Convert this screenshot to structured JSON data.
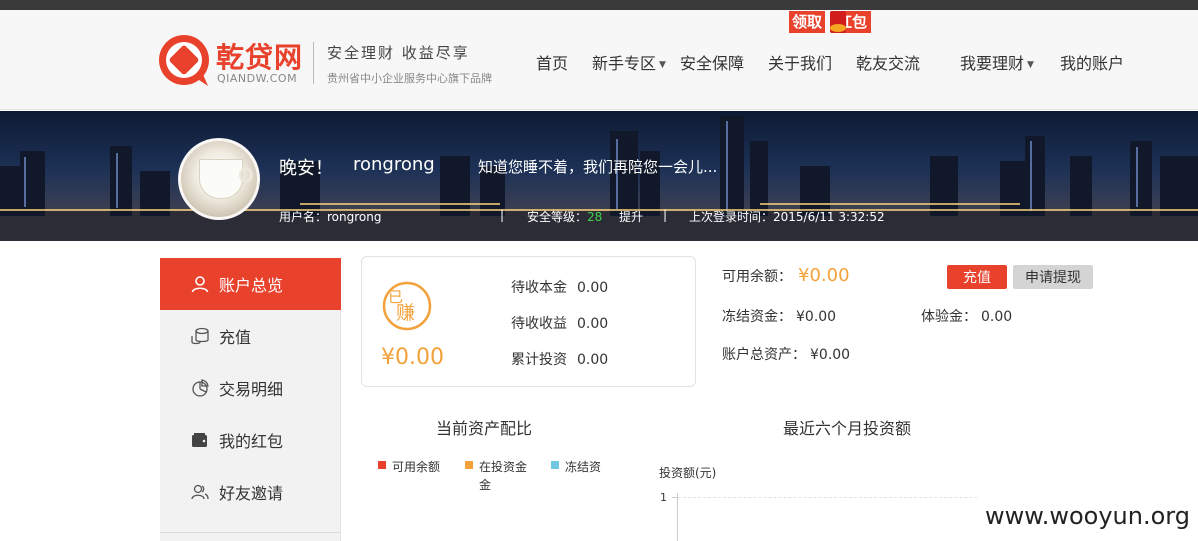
{
  "header": {
    "brand_cn": "乾贷网",
    "brand_en": "QIANDW.COM",
    "slogan": "安全理财 收益尽享",
    "slogan_sub": "贵州省中小企业服务中心旗下品牌",
    "nav": [
      "首页",
      "新手专区",
      "安全保障",
      "关于我们",
      "乾友交流",
      "我要理财",
      "我的账户"
    ],
    "promo": [
      "领取",
      "红包"
    ],
    "brand_color": "#e8412c"
  },
  "banner": {
    "greeting": "晚安！",
    "username": "rongrong",
    "message": "知道您睡不着，我们再陪您一会儿...",
    "username_label": "用户名：rongrong",
    "divider": "|",
    "level_label": "安全等级：",
    "level_value": "28",
    "improve": "提升",
    "last_login": "上次登录时间：2015/6/11 3:32:52"
  },
  "sidebar": {
    "items": [
      "账户总览",
      "充值",
      "交易明细",
      "我的红包",
      "好友邀请"
    ],
    "active_index": 0
  },
  "card": {
    "badge_top": "已",
    "badge_main": "赚",
    "earned": "¥0.00",
    "rows": [
      {
        "label": "待收本金",
        "value": "0.00"
      },
      {
        "label": "待收收益",
        "value": "0.00"
      },
      {
        "label": "累计投资",
        "value": "0.00"
      }
    ]
  },
  "balance": {
    "available_label": "可用余额：",
    "available_value": "¥0.00",
    "frozen_label": "冻结资金：",
    "frozen_value": "¥0.00",
    "trial_label": "体验金：",
    "trial_value": "0.00",
    "total_label": "账户总资产：",
    "total_value": "¥0.00",
    "recharge_btn": "充值",
    "withdraw_btn": "申请提现"
  },
  "charts": {
    "allocation_title": "当前资产配比",
    "allocation_legend": [
      {
        "name": "可用余额",
        "color": "#e8412c"
      },
      {
        "name": "在投资金金",
        "color": "#f3a23b"
      },
      {
        "name": "冻结资",
        "color": "#6fc9e0"
      }
    ],
    "invest_title": "最近六个月投资额",
    "invest_ylabel": "投资额(元)",
    "invest_ytick": "1"
  },
  "chart_data": {
    "type": "bar",
    "title": "最近六个月投资额",
    "xlabel": "",
    "ylabel": "投资额(元)",
    "ylim": [
      0,
      1
    ],
    "categories": [],
    "values": []
  },
  "watermark": "www.wooyun.org"
}
